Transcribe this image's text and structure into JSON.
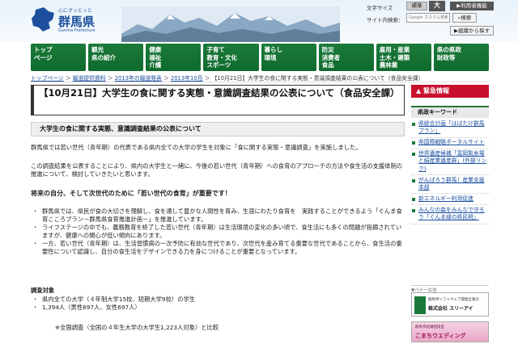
{
  "header": {
    "logo_sub": "心にグッとっと",
    "logo_name": "群馬県",
    "logo_en": "Gunma Prefecture",
    "font_size_label": "文字サイズ",
    "font_standard": "標準",
    "font_large": "大",
    "func_button": "▶利用者機能",
    "search_label": "サイト内検索：",
    "search_placeholder": "Google カスタム検索",
    "search_button": "検索",
    "org_button": "組織から探す"
  },
  "nav": [
    {
      "label": "トップ\nページ"
    },
    {
      "label": "観光\n県の紹介"
    },
    {
      "label": "健康\n福祉\n介護"
    },
    {
      "label": "子育て\n教育・文化\nスポーツ"
    },
    {
      "label": "暮らし\n環境"
    },
    {
      "label": "防災\n消費者\n食品"
    },
    {
      "label": "雇用・産業\n土木・建築\n農林業"
    },
    {
      "label": "県の県政\n財政等"
    }
  ],
  "breadcrumb": {
    "items": [
      "トップページ",
      "報道提供資料",
      "2013年の報道発表",
      "2013年10月"
    ],
    "current": "【10月21日】大学生の食に関する実態・意識調査結果の公表について（食品安全課）",
    "sep": " ＞ "
  },
  "main": {
    "title": "【10月21日】大学生の食に関する実態・意識調査結果の公表について（食品安全課）",
    "section_heading": "大学生の食に関する実態、意識調査結果の公表について",
    "para1": "群馬県では若い世代（青年期）の代表である県内全ての大学の学生を対象に「食に関する実態・意識調査」を実施しました。",
    "para2": "この調査結果を公表することにより、県内の大学生と一緒に、今後の若い世代（青年期）への食育のアプローチの方法や食生活の支援体制の推進について、検討していきたいと思います。",
    "emphasis": "将来の自分、そして次世代のために「若い世代の食育」が重要です！",
    "bullets": [
      "群馬県では、県民が食の大切さを理解し、食を通して豊かな人間性を育み、生涯にわたり食育を　実践することができるよう「ぐんま食育こころプラン－群馬県食育推進計画－」を推進しています。",
      "ライフステージの中でも、義務教育を終了した若い世代（青年期）は生活環境の変化の多い頃で、食生活にも多くの問題が指摘されていますが、健康への関心が低い傾向にあります。",
      "一方、若い世代（青年期）は、生活習慣病の一次予防に有効な世代であり、次世代を産み育てる重要な世代であることから、食生活の重要性について認識し、自分の食生活をデザインできる力を身につけることが重要となっています。"
    ],
    "survey_label": "調査対象",
    "survey_items": [
      "県内全ての大学（４年制大学15校、短期大学9校）の学生",
      "1,394人（男性697人、女性697人）"
    ],
    "note": "※全国調査（全国の４年生大学の大学生1,223人対象）と比較"
  },
  "side": {
    "urgent": "緊急情報",
    "keyword_heading": "県政キーワード",
    "keywords": [
      "県総合計画「はばたけ群馬プラン」",
      "県国際戦略ポータルサイト",
      "世界遺産候補「富岡製糸場と絹産業遺産群」(外部リンク)",
      "がんばろう群馬！産業支援本部",
      "新エネルギー利用促進",
      "みんなの森をみんなで守ろう「ぐんま緑の県民税」"
    ],
    "banner_label": "▼バナー広告",
    "banner1_small": "群馬県ソフトウェア開発企業の",
    "banner1_big": "株式会社 スリーアイ",
    "banner2_small": "群馬県結婚相談室",
    "banner2_big": "こまちウエディング"
  },
  "colors": {
    "nav_green": "#1b7a3a",
    "urgent_red": "#c8102e",
    "link_blue": "#1a4ea0"
  }
}
